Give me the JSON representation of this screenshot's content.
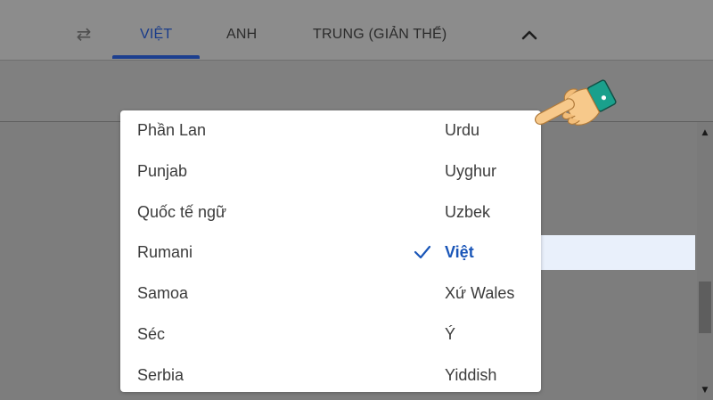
{
  "header": {
    "swap_icon": "swap-horiz-icon",
    "tabs": [
      {
        "label": "VIỆT",
        "active": true
      },
      {
        "label": "ANH",
        "active": false
      },
      {
        "label": "TRUNG (GIẢN THỂ)",
        "active": false
      }
    ],
    "collapse_icon": "chevron-up-icon"
  },
  "dropdown": {
    "left_column": [
      "Phần Lan",
      "Punjab",
      "Quốc tế ngữ",
      "Rumani",
      "Samoa",
      "Séc",
      "Serbia"
    ],
    "right_column": [
      "Urdu",
      "Uyghur",
      "Uzbek",
      "Việt",
      "Xứ Wales",
      "Ý",
      "Yiddish"
    ],
    "selected": "Việt",
    "selected_icon": "check-icon"
  },
  "colors": {
    "accent": "#1a56b8",
    "selected_bg": "#e9f0fb",
    "overlay": "#7d7d7d"
  }
}
